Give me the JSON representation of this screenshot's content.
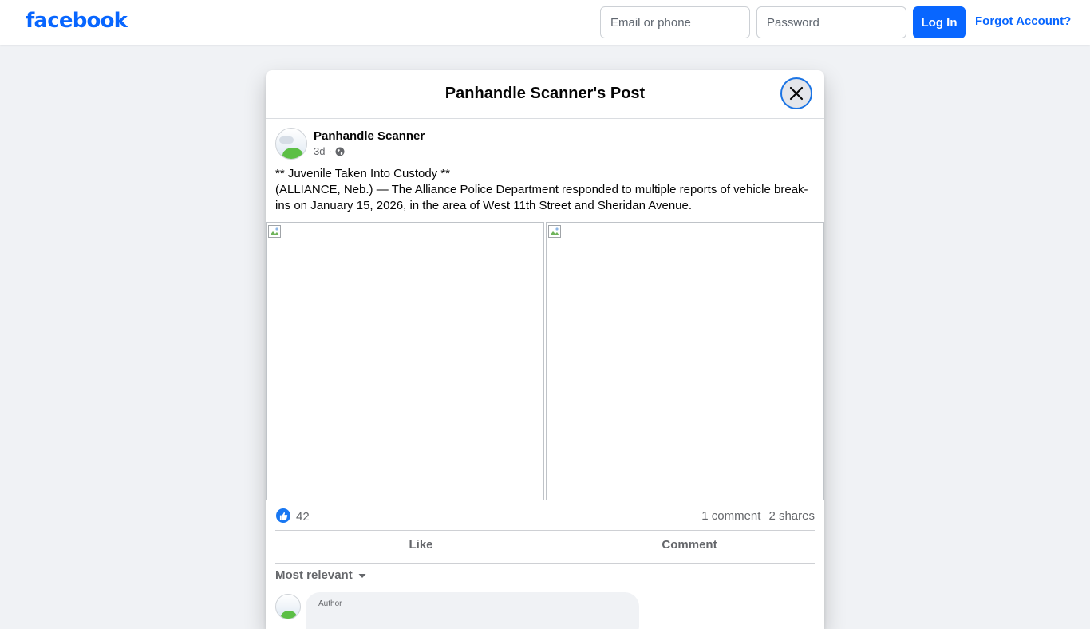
{
  "topbar": {
    "logo": "facebook",
    "email_placeholder": "Email or phone",
    "password_placeholder": "Password",
    "login_label": "Log In",
    "forgot_label": "Forgot Account?"
  },
  "dialog": {
    "title": "Panhandle Scanner's Post"
  },
  "post": {
    "author": "Panhandle Scanner",
    "time": "3d",
    "separator": "·",
    "audience_icon": "globe-icon",
    "text_line1": "** Juvenile Taken Into Custody **",
    "text_line2": "(ALLIANCE, Neb.) — The Alliance Police Department responded to multiple reports of vehicle break-ins on January 15, 2026, in the area of West 11th Street and Sheridan Avenue.",
    "image_count": 2
  },
  "stats": {
    "likes": "42",
    "comments": "1 comment",
    "shares": "2 shares"
  },
  "actions": {
    "like_label": "Like",
    "comment_label": "Comment"
  },
  "comments_section": {
    "sort_label": "Most relevant",
    "first_comment_badge": "Author"
  },
  "colors": {
    "brand": "#0866ff",
    "background": "#f0f2f5",
    "muted_text": "#65676b"
  }
}
